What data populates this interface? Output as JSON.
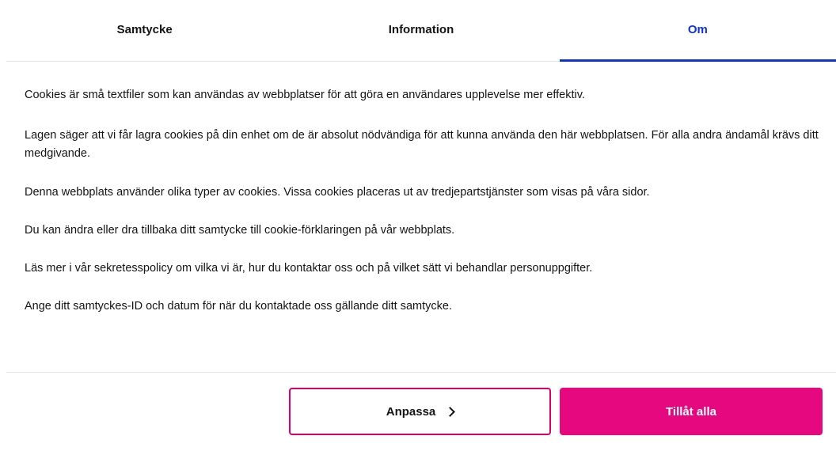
{
  "tabs": [
    {
      "label": "Samtycke",
      "active": false
    },
    {
      "label": "Information",
      "active": false
    },
    {
      "label": "Om",
      "active": true
    }
  ],
  "content": {
    "paragraphs": [
      "Cookies är små textfiler som kan användas av webbplatser för att göra en användares upplevelse mer effektiv.",
      "Lagen säger att vi får lagra cookies på din enhet om de är absolut nödvändiga för att kunna använda den här webbplatsen. För alla andra ändamål krävs ditt medgivande.",
      "Denna webbplats använder olika typer av cookies. Vissa cookies placeras ut av tredjepartstjänster som visas på våra sidor.",
      "Du kan ändra eller dra tillbaka ditt samtycke till cookie-förklaringen på vår webbplats.",
      "Läs mer i vår sekretesspolicy om vilka vi är, hur du kontaktar oss och på vilket sätt vi behandlar personuppgifter.",
      "Ange ditt samtyckes-ID och datum för när du kontaktade oss gällande ditt samtycke."
    ]
  },
  "buttons": {
    "customize_label": "Anpassa",
    "customize_icon": "chevron-right-icon",
    "allow_all_label": "Tillåt alla"
  },
  "colors": {
    "active_tab": "#1032cf",
    "accent": "#e5087e",
    "outline": "#d6006e"
  }
}
